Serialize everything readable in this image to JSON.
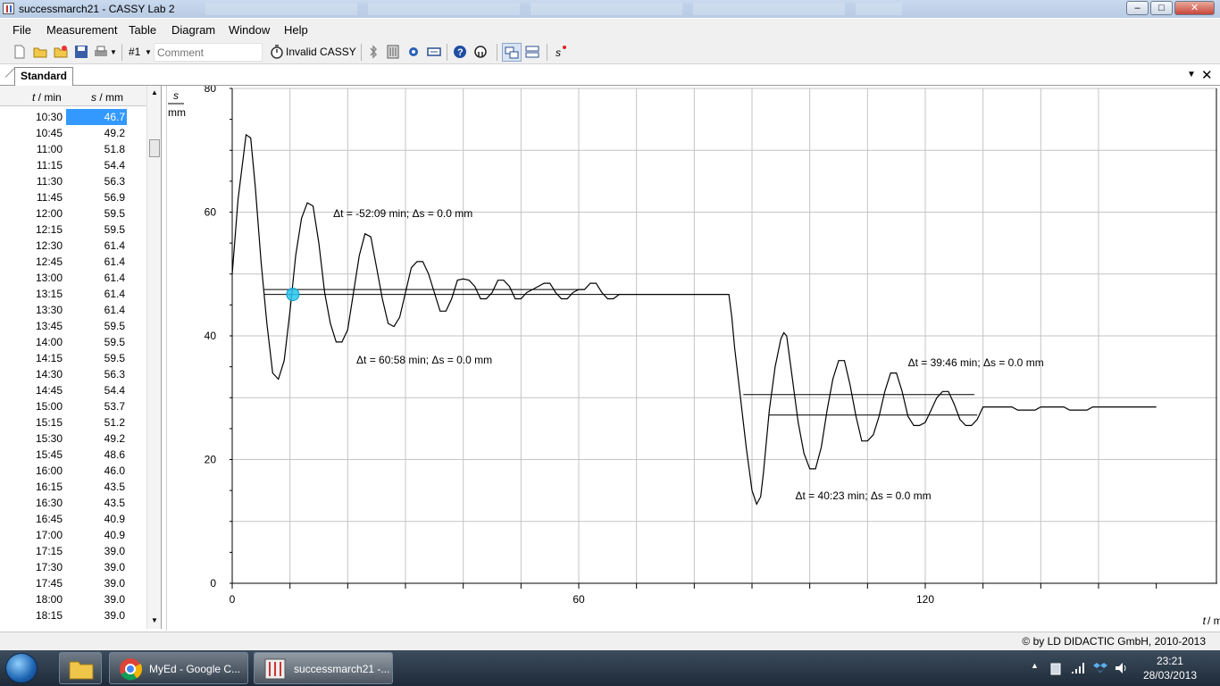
{
  "window": {
    "title": "successmarch21 - CASSY Lab 2",
    "controls": {
      "minimize": "–",
      "maximize": "□",
      "close": "✕"
    }
  },
  "menu": [
    "File",
    "Measurement",
    "Table",
    "Diagram",
    "Window",
    "Help"
  ],
  "toolbar": {
    "channel": "#1",
    "comment_placeholder": "Comment",
    "status": "Invalid CASSY",
    "s_button": "s"
  },
  "tab": {
    "label": "Standard"
  },
  "table": {
    "col_t": {
      "sym": "t",
      "unit": " / min"
    },
    "col_s": {
      "sym": "s",
      "unit": " / mm"
    },
    "rows": [
      [
        "10:30",
        "46.7"
      ],
      [
        "10:45",
        "49.2"
      ],
      [
        "11:00",
        "51.8"
      ],
      [
        "11:15",
        "54.4"
      ],
      [
        "11:30",
        "56.3"
      ],
      [
        "11:45",
        "56.9"
      ],
      [
        "12:00",
        "59.5"
      ],
      [
        "12:15",
        "59.5"
      ],
      [
        "12:30",
        "61.4"
      ],
      [
        "12:45",
        "61.4"
      ],
      [
        "13:00",
        "61.4"
      ],
      [
        "13:15",
        "61.4"
      ],
      [
        "13:30",
        "61.4"
      ],
      [
        "13:45",
        "59.5"
      ],
      [
        "14:00",
        "59.5"
      ],
      [
        "14:15",
        "59.5"
      ],
      [
        "14:30",
        "56.3"
      ],
      [
        "14:45",
        "54.4"
      ],
      [
        "15:00",
        "53.7"
      ],
      [
        "15:15",
        "51.2"
      ],
      [
        "15:30",
        "49.2"
      ],
      [
        "15:45",
        "48.6"
      ],
      [
        "16:00",
        "46.0"
      ],
      [
        "16:15",
        "43.5"
      ],
      [
        "16:30",
        "43.5"
      ],
      [
        "16:45",
        "40.9"
      ],
      [
        "17:00",
        "40.9"
      ],
      [
        "17:15",
        "39.0"
      ],
      [
        "17:30",
        "39.0"
      ],
      [
        "17:45",
        "39.0"
      ],
      [
        "18:00",
        "39.0"
      ],
      [
        "18:15",
        "39.0"
      ]
    ]
  },
  "chart_data": {
    "type": "line",
    "y_symbol": "s",
    "y_unit": "mm",
    "x_symbol": "t",
    "x_unit": "/ min",
    "xlim": [
      0,
      160
    ],
    "ylim": [
      0,
      80
    ],
    "x_ticks": [
      0,
      60,
      120
    ],
    "y_ticks": [
      0,
      20,
      40,
      60,
      80
    ],
    "grid": true,
    "series": [
      {
        "points": [
          [
            0,
            50
          ],
          [
            1,
            62
          ],
          [
            2.4,
            72.5
          ],
          [
            3.2,
            72
          ],
          [
            4,
            64
          ],
          [
            5,
            52
          ],
          [
            6,
            42
          ],
          [
            7,
            34
          ],
          [
            8,
            33
          ],
          [
            9,
            36
          ],
          [
            10,
            44
          ],
          [
            11,
            53
          ],
          [
            12,
            59
          ],
          [
            13,
            61.5
          ],
          [
            14,
            61
          ],
          [
            15,
            55
          ],
          [
            16,
            47
          ],
          [
            17,
            42
          ],
          [
            18,
            39
          ],
          [
            19,
            39
          ],
          [
            20,
            41
          ],
          [
            21,
            47
          ],
          [
            22,
            53
          ],
          [
            23,
            56.5
          ],
          [
            24,
            56
          ],
          [
            25,
            51
          ],
          [
            26,
            46
          ],
          [
            27,
            42
          ],
          [
            28,
            41.5
          ],
          [
            29,
            43
          ],
          [
            30,
            47
          ],
          [
            31,
            51
          ],
          [
            32,
            52
          ],
          [
            33,
            52
          ],
          [
            34,
            50
          ],
          [
            35,
            47
          ],
          [
            36,
            44
          ],
          [
            37,
            44
          ],
          [
            38,
            46
          ],
          [
            39,
            49
          ],
          [
            40,
            49.2
          ],
          [
            41,
            49
          ],
          [
            42,
            48
          ],
          [
            43,
            46
          ],
          [
            44,
            46
          ],
          [
            45,
            47
          ],
          [
            46,
            49
          ],
          [
            47,
            49
          ],
          [
            48,
            48
          ],
          [
            49,
            46
          ],
          [
            50,
            46
          ],
          [
            51,
            47
          ],
          [
            52,
            47.5
          ],
          [
            53,
            48
          ],
          [
            54,
            48.5
          ],
          [
            55,
            48.5
          ],
          [
            56,
            47
          ],
          [
            57,
            46
          ],
          [
            58,
            46
          ],
          [
            59,
            47
          ],
          [
            60,
            47.5
          ],
          [
            61,
            47.5
          ],
          [
            62,
            48.5
          ],
          [
            63,
            48.5
          ],
          [
            64,
            47
          ],
          [
            65,
            46
          ],
          [
            66,
            46
          ],
          [
            67,
            46.7
          ],
          [
            86,
            46.7
          ],
          [
            86.5,
            43
          ],
          [
            87,
            38
          ],
          [
            88,
            30
          ],
          [
            89,
            22
          ],
          [
            90,
            15
          ],
          [
            90.8,
            12.8
          ],
          [
            91.5,
            14
          ],
          [
            92,
            18
          ],
          [
            93,
            28
          ],
          [
            94,
            35
          ],
          [
            95,
            39.5
          ],
          [
            95.5,
            40.5
          ],
          [
            96,
            40
          ],
          [
            97,
            33
          ],
          [
            98,
            26
          ],
          [
            99,
            21
          ],
          [
            100,
            18.5
          ],
          [
            101,
            18.5
          ],
          [
            102,
            22
          ],
          [
            103,
            28
          ],
          [
            104,
            33
          ],
          [
            105,
            36
          ],
          [
            106,
            36
          ],
          [
            107,
            32
          ],
          [
            108,
            27
          ],
          [
            109,
            23
          ],
          [
            110,
            23
          ],
          [
            111,
            24
          ],
          [
            112,
            27
          ],
          [
            113,
            31
          ],
          [
            114,
            34
          ],
          [
            115,
            34
          ],
          [
            116,
            31
          ],
          [
            117,
            27
          ],
          [
            118,
            25.5
          ],
          [
            119,
            25.5
          ],
          [
            120,
            26
          ],
          [
            121,
            28
          ],
          [
            122,
            30
          ],
          [
            123,
            31
          ],
          [
            124,
            31
          ],
          [
            125,
            29
          ],
          [
            126,
            26.5
          ],
          [
            127,
            25.5
          ],
          [
            128,
            25.5
          ],
          [
            129,
            26.5
          ],
          [
            130,
            28.5
          ],
          [
            135,
            28.5
          ],
          [
            136,
            28
          ],
          [
            139,
            28
          ],
          [
            140,
            28.5
          ],
          [
            144,
            28.5
          ],
          [
            145,
            28
          ],
          [
            148,
            28
          ],
          [
            149,
            28.5
          ],
          [
            160,
            28.5
          ]
        ]
      }
    ],
    "markers": [
      {
        "x": 10.5,
        "y": 46.7
      }
    ],
    "annotations": [
      {
        "text": "Δt = -52:09 min;   Δs =  0.0 mm",
        "x": 17.5,
        "y": 59.2
      },
      {
        "text": "Δt =  60:58 min;   Δs =  0.0 mm",
        "x": 21.5,
        "y": 35.5
      },
      {
        "text": "Δt =  39:46 min;   Δs =  0.0 mm",
        "x": 117.0,
        "y": 35.1
      },
      {
        "text": "Δt =  40:23 min;   Δs =  0.0 mm",
        "x": 97.5,
        "y": 13.6
      }
    ],
    "guide_lines": [
      {
        "x1": 5.5,
        "x2": 61.0,
        "y": 47.5
      },
      {
        "x1": 5.5,
        "x2": 67.0,
        "y": 46.7
      },
      {
        "x1": 88.5,
        "x2": 128.5,
        "y": 30.5
      },
      {
        "x1": 93.0,
        "x2": 129.0,
        "y": 27.2
      }
    ]
  },
  "status": {
    "copyright": "© by LD DIDACTIC GmbH, 2010-2013"
  },
  "taskbar": {
    "items": [
      "MyEd - Google C...",
      "successmarch21 -..."
    ],
    "time": "23:21",
    "date": "28/03/2013"
  }
}
